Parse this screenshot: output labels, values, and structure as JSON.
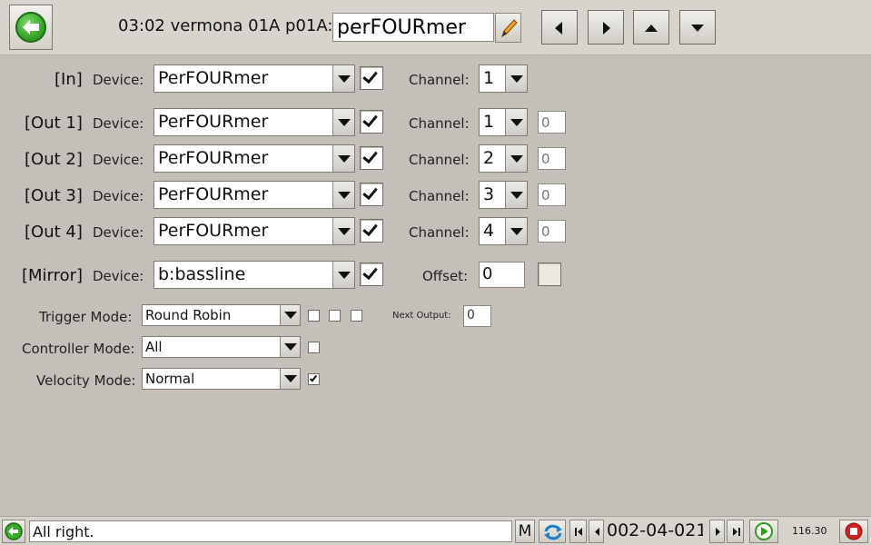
{
  "header": {
    "title": "03:02 vermona 01A p01A:",
    "name_value": "perFOURmer",
    "buttons": [
      "back-icon",
      "pencil-icon",
      "arrow-left-icon",
      "arrow-right-icon",
      "arrow-up-icon",
      "arrow-down-icon"
    ]
  },
  "labels": {
    "device": "Device:",
    "channel": "Channel:",
    "offset": "Offset:",
    "trigger_mode": "Trigger Mode:",
    "controller_mode": "Controller Mode:",
    "velocity_mode": "Velocity Mode:",
    "next_output": "Next Output:"
  },
  "rows": {
    "in": {
      "label": "[In]",
      "device": "PerFOURmer",
      "enabled": true,
      "channel": "1"
    },
    "out1": {
      "label": "[Out 1]",
      "device": "PerFOURmer",
      "enabled": true,
      "channel": "1",
      "transpose": "0"
    },
    "out2": {
      "label": "[Out 2]",
      "device": "PerFOURmer",
      "enabled": true,
      "channel": "2",
      "transpose": "0"
    },
    "out3": {
      "label": "[Out 3]",
      "device": "PerFOURmer",
      "enabled": true,
      "channel": "3",
      "transpose": "0"
    },
    "out4": {
      "label": "[Out 4]",
      "device": "PerFOURmer",
      "enabled": true,
      "channel": "4",
      "transpose": "0"
    },
    "mirror": {
      "label": "[Mirror]",
      "device": "b:bassline",
      "enabled": true,
      "offset": "0",
      "offset_enabled": false
    }
  },
  "modes": {
    "trigger": {
      "value": "Round Robin",
      "checks": [
        false,
        false,
        false
      ],
      "next_output": "0"
    },
    "controller": {
      "value": "All",
      "check": false
    },
    "velocity": {
      "value": "Normal",
      "check": true
    }
  },
  "status": {
    "message": "All right.",
    "m_label": "M",
    "position": "002-04-021",
    "tempo": "116.30",
    "icons": [
      "back-icon",
      "sync-icon",
      "skip-start-icon",
      "step-back-icon",
      "step-forward-icon",
      "skip-end-icon",
      "play-icon",
      "stop-icon"
    ]
  },
  "colors": {
    "background": "#c4c0b9",
    "play": "#2f9a22",
    "stop": "#d02020"
  }
}
